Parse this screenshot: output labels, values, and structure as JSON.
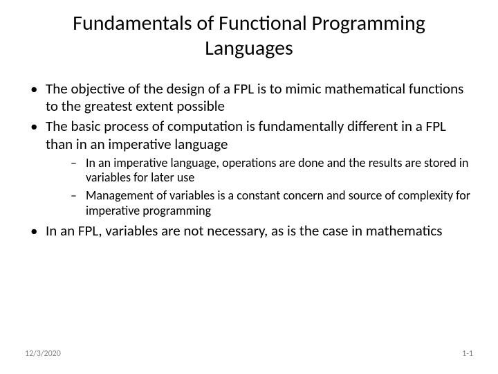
{
  "title": "Fundamentals of Functional Programming Languages",
  "bullets": {
    "b1": "The objective of the design of a FPL is to mimic mathematical functions to the greatest extent possible",
    "b2": "The basic process of computation is fundamentally different in a FPL than in an imperative language",
    "b2_sub1": "In an imperative language, operations are done and the results are stored in variables for later use",
    "b2_sub2": "Management of variables is a constant concern and source of complexity for imperative programming",
    "b3": "In an FPL, variables are not necessary, as is the case in mathematics"
  },
  "footer": {
    "date": "12/3/2020",
    "page": "1-1"
  }
}
